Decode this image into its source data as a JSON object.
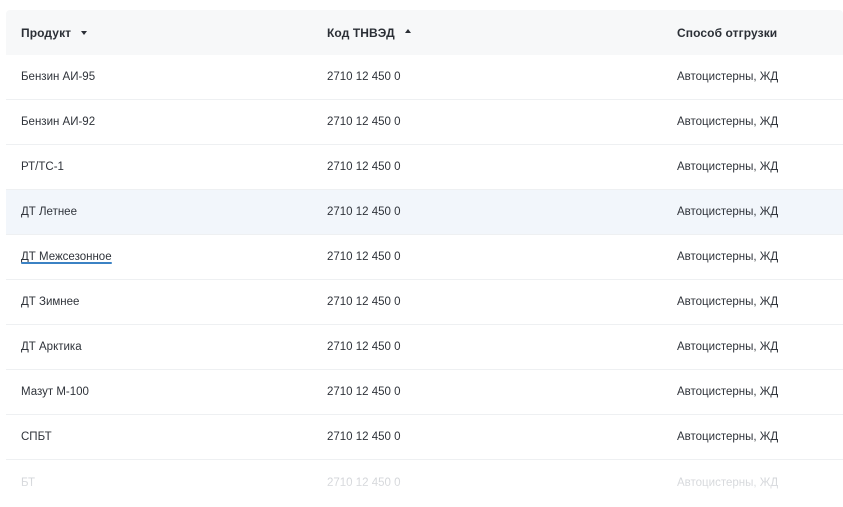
{
  "table": {
    "columns": {
      "product": {
        "label": "Продукт",
        "sort": "desc"
      },
      "code": {
        "label": "Код ТНВЭД",
        "sort": "asc"
      },
      "shipping": {
        "label": "Способ отгрузки"
      }
    },
    "rows": [
      {
        "product": "Бензин АИ-95",
        "code": "2710 12 450 0",
        "shipping": "Автоцистерны, ЖД"
      },
      {
        "product": "Бензин АИ-92",
        "code": "2710 12 450 0",
        "shipping": "Автоцистерны, ЖД"
      },
      {
        "product": "РТ/ТС-1",
        "code": "2710 12 450 0",
        "shipping": "Автоцистерны, ЖД"
      },
      {
        "product": "ДТ Летнее",
        "code": "2710 12 450 0",
        "shipping": "Автоцистерны, ЖД",
        "highlighted": true
      },
      {
        "product": "ДТ Межсезонное",
        "code": "2710 12 450 0",
        "shipping": "Автоцистерны, ЖД",
        "underlined": true
      },
      {
        "product": "ДТ Зимнее",
        "code": "2710 12 450 0",
        "shipping": "Автоцистерны, ЖД"
      },
      {
        "product": "ДТ Арктика",
        "code": "2710 12 450 0",
        "shipping": "Автоцистерны, ЖД"
      },
      {
        "product": "Мазут М-100",
        "code": "2710 12 450 0",
        "shipping": "Автоцистерны, ЖД"
      },
      {
        "product": "СПБТ",
        "code": "2710 12 450 0",
        "shipping": "Автоцистерны, ЖД"
      },
      {
        "product": "БТ",
        "code": "2710 12 450 0",
        "shipping": "Автоцистерны, ЖД",
        "faded": true
      }
    ]
  },
  "icons": {
    "product_sort": "sort-descending-icon",
    "code_sort": "sort-ascending-icon"
  },
  "colors": {
    "highlight_row": "#f2f6fb",
    "link_underline": "#3b82c4",
    "header_bg": "#f7f8f9"
  }
}
